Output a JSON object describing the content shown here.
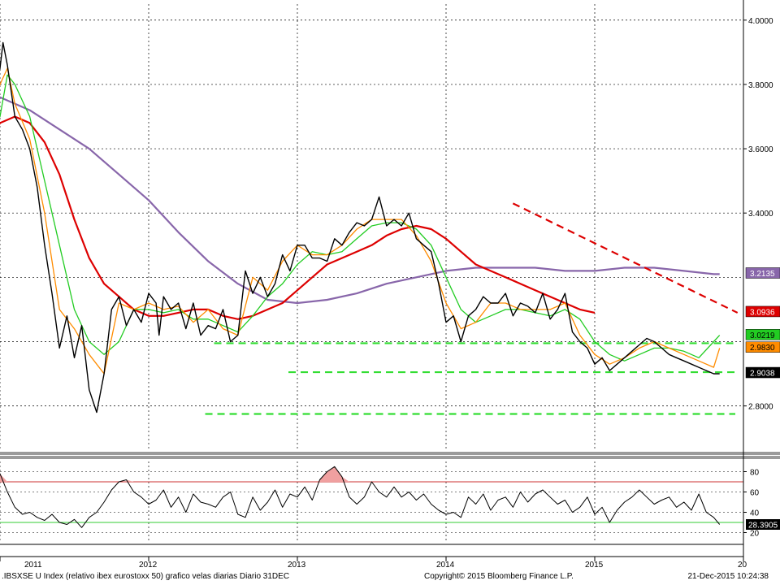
{
  "chart_data": {
    "type": "line",
    "footer": {
      "title": ".IBSXSE U Index (relativo ibex eurostoxx 50) grafico velas diarias  Diario 31DEC",
      "copyright": "Copyright© 2015 Bloomberg Finance L.P.",
      "timestamp": "21-Dec-2015 10:24:38"
    },
    "x_axis": {
      "labels": [
        "2011",
        "2012",
        "2013",
        "2014",
        "2015",
        "20"
      ],
      "range": [
        2011.0,
        2016.0
      ]
    },
    "main_panel": {
      "y_ticks": [
        "4.0000",
        "3.8000",
        "3.6000",
        "3.4000",
        "2.8000"
      ],
      "y_tick_values": [
        4.0,
        3.8,
        3.6,
        3.4,
        2.8
      ],
      "ylim": [
        2.66,
        4.05
      ],
      "grid": true,
      "colors": {
        "price": "#000000",
        "ma_fast": "#ff8c00",
        "ma_mid": "#22cc22",
        "ma_slow": "#dd0000",
        "ma_long": "#8866aa",
        "support": "#33dd33",
        "trendline": "#dd0000"
      },
      "series": [
        {
          "key": "price",
          "x": [
            2010.9,
            2010.95,
            2011.0,
            2011.02,
            2011.05,
            2011.1,
            2011.15,
            2011.2,
            2011.25,
            2011.3,
            2011.35,
            2011.4,
            2011.45,
            2011.5,
            2011.55,
            2011.6,
            2011.65,
            2011.7,
            2011.75,
            2011.8,
            2011.85,
            2011.9,
            2011.95,
            2012.0,
            2012.05,
            2012.07,
            2012.1,
            2012.15,
            2012.2,
            2012.25,
            2012.3,
            2012.35,
            2012.4,
            2012.45,
            2012.5,
            2012.55,
            2012.6,
            2012.65,
            2012.7,
            2012.75,
            2012.8,
            2012.85,
            2012.9,
            2012.95,
            2013.0,
            2013.05,
            2013.1,
            2013.15,
            2013.2,
            2013.25,
            2013.3,
            2013.35,
            2013.4,
            2013.45,
            2013.5,
            2013.55,
            2013.6,
            2013.65,
            2013.7,
            2013.75,
            2013.8,
            2013.85,
            2013.9,
            2013.95,
            2014.0,
            2014.05,
            2014.1,
            2014.15,
            2014.2,
            2014.25,
            2014.3,
            2014.35,
            2014.4,
            2014.45,
            2014.5,
            2014.55,
            2014.6,
            2014.65,
            2014.7,
            2014.75,
            2014.8,
            2014.85,
            2014.9,
            2014.95,
            2015.0,
            2015.05,
            2015.1,
            2015.15,
            2015.2,
            2015.25,
            2015.3,
            2015.35,
            2015.4,
            2015.45,
            2015.5,
            2015.55,
            2015.6,
            2015.65,
            2015.7,
            2015.75,
            2015.8,
            2015.84
          ],
          "y": [
            3.6,
            3.74,
            3.85,
            3.93,
            3.86,
            3.7,
            3.66,
            3.6,
            3.48,
            3.3,
            3.15,
            2.98,
            3.08,
            2.95,
            3.05,
            2.85,
            2.78,
            2.9,
            3.1,
            3.14,
            3.05,
            3.1,
            3.06,
            3.15,
            3.12,
            3.02,
            3.14,
            3.1,
            3.12,
            3.04,
            3.12,
            3.02,
            3.05,
            3.04,
            3.1,
            3.0,
            3.02,
            3.22,
            3.15,
            3.2,
            3.14,
            3.18,
            3.27,
            3.22,
            3.3,
            3.3,
            3.26,
            3.26,
            3.25,
            3.32,
            3.3,
            3.34,
            3.37,
            3.36,
            3.38,
            3.45,
            3.36,
            3.38,
            3.36,
            3.4,
            3.32,
            3.3,
            3.28,
            3.18,
            3.06,
            3.08,
            3.0,
            3.08,
            3.1,
            3.14,
            3.12,
            3.12,
            3.15,
            3.08,
            3.12,
            3.11,
            3.09,
            3.15,
            3.07,
            3.1,
            3.15,
            3.03,
            3.0,
            2.98,
            2.93,
            2.95,
            2.91,
            2.93,
            2.95,
            2.97,
            2.99,
            3.01,
            3.0,
            2.98,
            2.96,
            2.95,
            2.94,
            2.93,
            2.92,
            2.91,
            2.9,
            2.9
          ]
        },
        {
          "key": "ma_fast",
          "x": [
            2010.9,
            2011.0,
            2011.05,
            2011.1,
            2011.2,
            2011.3,
            2011.4,
            2011.5,
            2011.6,
            2011.7,
            2011.8,
            2011.9,
            2012.0,
            2012.1,
            2012.2,
            2012.3,
            2012.4,
            2012.5,
            2012.6,
            2012.7,
            2012.8,
            2012.9,
            2013.0,
            2013.1,
            2013.2,
            2013.3,
            2013.4,
            2013.5,
            2013.6,
            2013.7,
            2013.8,
            2013.9,
            2014.0,
            2014.1,
            2014.2,
            2014.3,
            2014.4,
            2014.5,
            2014.6,
            2014.7,
            2014.8,
            2014.9,
            2015.0,
            2015.1,
            2015.2,
            2015.3,
            2015.4,
            2015.5,
            2015.6,
            2015.7,
            2015.8,
            2015.84
          ],
          "y": [
            3.62,
            3.8,
            3.85,
            3.74,
            3.63,
            3.4,
            3.1,
            3.04,
            2.96,
            2.9,
            3.12,
            3.1,
            3.12,
            3.1,
            3.11,
            3.06,
            3.1,
            3.04,
            3.02,
            3.2,
            3.16,
            3.25,
            3.3,
            3.27,
            3.27,
            3.3,
            3.35,
            3.38,
            3.38,
            3.38,
            3.33,
            3.25,
            3.12,
            3.04,
            3.06,
            3.12,
            3.12,
            3.1,
            3.1,
            3.1,
            3.12,
            3.02,
            2.96,
            2.93,
            2.95,
            2.98,
            3.0,
            2.98,
            2.96,
            2.94,
            2.92,
            2.98
          ]
        },
        {
          "key": "ma_mid",
          "x": [
            2010.9,
            2011.0,
            2011.05,
            2011.1,
            2011.2,
            2011.3,
            2011.4,
            2011.5,
            2011.6,
            2011.7,
            2011.8,
            2011.9,
            2012.0,
            2012.1,
            2012.2,
            2012.3,
            2012.4,
            2012.5,
            2012.6,
            2012.7,
            2012.8,
            2012.9,
            2013.0,
            2013.1,
            2013.2,
            2013.3,
            2013.4,
            2013.5,
            2013.6,
            2013.7,
            2013.8,
            2013.9,
            2014.0,
            2014.1,
            2014.2,
            2014.3,
            2014.4,
            2014.5,
            2014.6,
            2014.7,
            2014.8,
            2014.9,
            2015.0,
            2015.1,
            2015.2,
            2015.3,
            2015.4,
            2015.5,
            2015.6,
            2015.7,
            2015.8,
            2015.84
          ],
          "y": [
            3.62,
            3.7,
            3.83,
            3.8,
            3.7,
            3.5,
            3.3,
            3.1,
            3.0,
            2.96,
            3.0,
            3.1,
            3.1,
            3.09,
            3.1,
            3.07,
            3.07,
            3.05,
            3.03,
            3.08,
            3.14,
            3.18,
            3.24,
            3.28,
            3.27,
            3.28,
            3.32,
            3.36,
            3.37,
            3.37,
            3.35,
            3.3,
            3.2,
            3.1,
            3.06,
            3.08,
            3.1,
            3.1,
            3.09,
            3.08,
            3.1,
            3.07,
            3.0,
            2.96,
            2.94,
            2.96,
            2.98,
            2.98,
            2.97,
            2.95,
            3.0,
            3.02
          ]
        },
        {
          "key": "ma_slow",
          "x": [
            2010.9,
            2011.0,
            2011.1,
            2011.2,
            2011.3,
            2011.4,
            2011.5,
            2011.6,
            2011.7,
            2011.8,
            2011.9,
            2012.0,
            2012.1,
            2012.2,
            2012.3,
            2012.4,
            2012.5,
            2012.6,
            2012.7,
            2012.8,
            2012.9,
            2013.0,
            2013.1,
            2013.2,
            2013.3,
            2013.4,
            2013.5,
            2013.6,
            2013.7,
            2013.8,
            2013.9,
            2014.0,
            2014.1,
            2014.2,
            2014.3,
            2014.4,
            2014.5,
            2014.6,
            2014.7,
            2014.8,
            2014.9,
            2015.0,
            2015.1,
            2015.2,
            2015.3,
            2015.4,
            2015.5,
            2015.6,
            2015.7,
            2015.8,
            2015.84
          ],
          "y": [
            3.6,
            3.68,
            3.7,
            3.68,
            3.62,
            3.52,
            3.38,
            3.26,
            3.18,
            3.14,
            3.1,
            3.08,
            3.08,
            3.09,
            3.1,
            3.1,
            3.08,
            3.07,
            3.08,
            3.1,
            3.12,
            3.16,
            3.2,
            3.24,
            3.26,
            3.28,
            3.3,
            3.33,
            3.35,
            3.36,
            3.35,
            3.32,
            3.28,
            3.24,
            3.22,
            3.2,
            3.18,
            3.16,
            3.14,
            3.12,
            3.1,
            3.09
          ]
        },
        {
          "key": "ma_long",
          "x": [
            2010.9,
            2011.0,
            2011.2,
            2011.4,
            2011.6,
            2011.8,
            2012.0,
            2012.2,
            2012.4,
            2012.6,
            2012.8,
            2013.0,
            2013.2,
            2013.4,
            2013.6,
            2013.8,
            2014.0,
            2014.2,
            2014.4,
            2014.6,
            2014.8,
            2015.0,
            2015.2,
            2015.4,
            2015.6,
            2015.8,
            2015.84
          ],
          "y": [
            3.78,
            3.76,
            3.72,
            3.66,
            3.6,
            3.52,
            3.44,
            3.34,
            3.25,
            3.18,
            3.13,
            3.12,
            3.13,
            3.15,
            3.18,
            3.2,
            3.22,
            3.23,
            3.23,
            3.23,
            3.22,
            3.22,
            3.23,
            3.23,
            3.22,
            3.21,
            3.21
          ]
        }
      ],
      "support_lines": [
        {
          "y": 2.995,
          "x_start": 2012.44
        },
        {
          "y": 2.905,
          "x_start": 2012.94
        },
        {
          "y": 2.775,
          "x_start": 2012.38
        }
      ],
      "trendline": {
        "x": [
          2014.45,
          2015.84
        ],
        "y": [
          3.43,
          3.11
        ]
      },
      "value_tags": [
        {
          "label": "3.2135",
          "value": 3.2135,
          "color": "#8866aa",
          "text_color": "#ffffff"
        },
        {
          "label": "3.0936",
          "value": 3.0936,
          "color": "#dd0000",
          "text_color": "#ffffff"
        },
        {
          "label": "3.0219",
          "value": 3.0219,
          "color": "#22cc22",
          "text_color": "#000000"
        },
        {
          "label": "2.9830",
          "value": 2.983,
          "color": "#ff8c00",
          "text_color": "#000000"
        },
        {
          "label": "2.9038",
          "value": 2.9038,
          "color": "#000000",
          "text_color": "#ffffff"
        }
      ]
    },
    "rsi_panel": {
      "y_ticks": [
        "80",
        "60",
        "40",
        "20"
      ],
      "y_tick_values": [
        80,
        60,
        40,
        20
      ],
      "ylim": [
        10,
        90
      ],
      "overbought": 70,
      "oversold": 30,
      "colors": {
        "line": "#000000",
        "overbought_line": "#cc3333",
        "oversold_line": "#33cc33",
        "overbought_fill": "#f0a0a0"
      },
      "series": {
        "x": [
          2010.9,
          2010.95,
          2011.0,
          2011.05,
          2011.1,
          2011.15,
          2011.2,
          2011.25,
          2011.3,
          2011.35,
          2011.4,
          2011.45,
          2011.5,
          2011.55,
          2011.6,
          2011.65,
          2011.7,
          2011.75,
          2011.8,
          2011.85,
          2011.9,
          2011.95,
          2012.0,
          2012.05,
          2012.1,
          2012.15,
          2012.2,
          2012.25,
          2012.3,
          2012.35,
          2012.4,
          2012.45,
          2012.5,
          2012.55,
          2012.6,
          2012.65,
          2012.7,
          2012.75,
          2012.8,
          2012.85,
          2012.9,
          2012.95,
          2013.0,
          2013.05,
          2013.1,
          2013.15,
          2013.2,
          2013.25,
          2013.3,
          2013.35,
          2013.4,
          2013.45,
          2013.5,
          2013.55,
          2013.6,
          2013.65,
          2013.7,
          2013.75,
          2013.8,
          2013.85,
          2013.9,
          2013.95,
          2014.0,
          2014.05,
          2014.1,
          2014.15,
          2014.2,
          2014.25,
          2014.3,
          2014.35,
          2014.4,
          2014.45,
          2014.5,
          2014.55,
          2014.6,
          2014.65,
          2014.7,
          2014.75,
          2014.8,
          2014.85,
          2014.9,
          2014.95,
          2015.0,
          2015.05,
          2015.1,
          2015.15,
          2015.2,
          2015.25,
          2015.3,
          2015.35,
          2015.4,
          2015.45,
          2015.5,
          2015.55,
          2015.6,
          2015.65,
          2015.7,
          2015.75,
          2015.8,
          2015.84
        ],
        "y": [
          72,
          75,
          78,
          60,
          45,
          38,
          40,
          35,
          32,
          38,
          30,
          28,
          33,
          25,
          35,
          40,
          50,
          62,
          70,
          72,
          60,
          55,
          48,
          52,
          62,
          45,
          55,
          40,
          58,
          50,
          48,
          45,
          55,
          60,
          38,
          35,
          55,
          42,
          50,
          62,
          45,
          58,
          55,
          65,
          52,
          72,
          80,
          85,
          75,
          55,
          48,
          55,
          70,
          60,
          55,
          65,
          55,
          60,
          52,
          58,
          48,
          42,
          38,
          40,
          35,
          55,
          48,
          58,
          42,
          52,
          55,
          45,
          60,
          50,
          58,
          62,
          55,
          48,
          52,
          40,
          45,
          55,
          38,
          45,
          30,
          42,
          50,
          55,
          62,
          55,
          48,
          52,
          55,
          45,
          50,
          42,
          58,
          40,
          35,
          28
        ]
      }
    }
  }
}
